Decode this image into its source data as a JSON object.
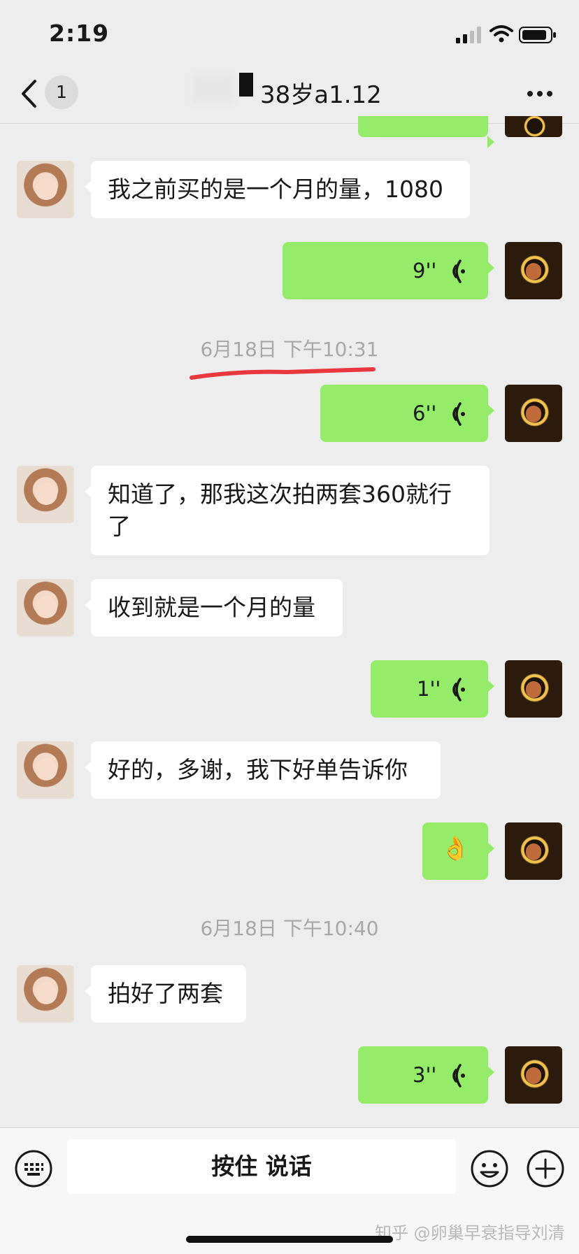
{
  "status_bar": {
    "time": "2:19"
  },
  "nav": {
    "unread_badge": "1",
    "title": "38岁a1.12"
  },
  "messages": [
    {
      "text": "我之前买的是一个月的量，1080"
    },
    {
      "voice": "9''"
    },
    {
      "timestamp": "6月18日 下午10:31"
    },
    {
      "voice": "6''"
    },
    {
      "text": "知道了，那我这次拍两套360就行了"
    },
    {
      "text": "收到就是一个月的量"
    },
    {
      "voice": "1''"
    },
    {
      "text": "好的，多谢，我下好单告诉你"
    },
    {
      "emoji": "👌"
    },
    {
      "timestamp": "6月18日 下午10:40"
    },
    {
      "text": "拍好了两套"
    },
    {
      "voice": "3''"
    }
  ],
  "bottom_bar": {
    "hold_to_talk": "按住 说话"
  },
  "watermark": "知乎 @卵巢早衰指导刘清",
  "colors": {
    "outgoing_bubble": "#95ec69",
    "incoming_bubble": "#ffffff",
    "background": "#ededed"
  }
}
